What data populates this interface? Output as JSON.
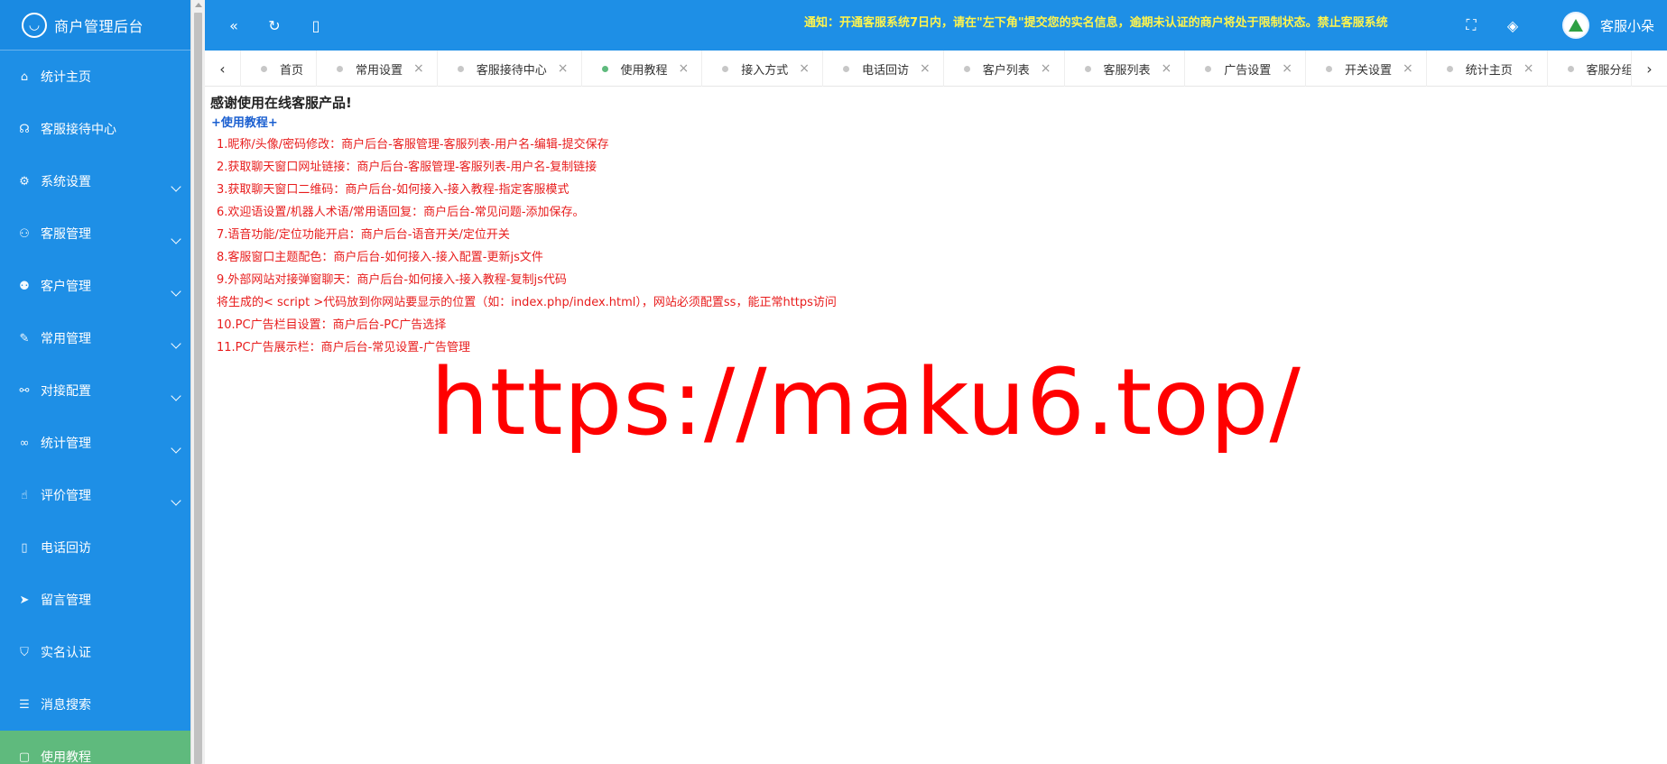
{
  "sidebar": {
    "brand": "商户管理后台",
    "items": [
      {
        "label": "统计主页",
        "icon": "home-icon",
        "glyph": "⌂",
        "dropdown": false
      },
      {
        "label": "客服接待中心",
        "icon": "headset-icon",
        "glyph": "☊",
        "dropdown": false
      },
      {
        "label": "系统设置",
        "icon": "gear-icon",
        "glyph": "⚙",
        "dropdown": true
      },
      {
        "label": "客服管理",
        "icon": "user-icon",
        "glyph": "⚇",
        "dropdown": true
      },
      {
        "label": "客户管理",
        "icon": "users-icon",
        "glyph": "⚉",
        "dropdown": true
      },
      {
        "label": "常用管理",
        "icon": "edit-icon",
        "glyph": "✎",
        "dropdown": true
      },
      {
        "label": "对接配置",
        "icon": "connect-icon",
        "glyph": "⚯",
        "dropdown": true
      },
      {
        "label": "统计管理",
        "icon": "infinity-icon",
        "glyph": "∞",
        "dropdown": true
      },
      {
        "label": "评价管理",
        "icon": "thumbs-up-icon",
        "glyph": "☝",
        "dropdown": true
      },
      {
        "label": "电话回访",
        "icon": "phone-icon",
        "glyph": "▯",
        "dropdown": false
      },
      {
        "label": "留言管理",
        "icon": "send-icon",
        "glyph": "➤",
        "dropdown": false
      },
      {
        "label": "实名认证",
        "icon": "shield-icon",
        "glyph": "⛉",
        "dropdown": false
      },
      {
        "label": "消息搜索",
        "icon": "list-icon",
        "glyph": "☰",
        "dropdown": false
      },
      {
        "label": "使用教程",
        "icon": "book-icon",
        "glyph": "▢",
        "dropdown": false,
        "active": true
      }
    ]
  },
  "header": {
    "notice": "通知：开通客服系统7日内，请在\"左下角\"提交您的实名信息，逾期未认证的商户将处于限制状态。禁止客服系统",
    "user_name": "客服小朵",
    "icons": {
      "collapse": "«",
      "refresh": "↻",
      "mobile": "▯",
      "fullscreen": "⛶",
      "layers": "◈"
    }
  },
  "tabs": {
    "prev": "‹",
    "next": "›",
    "close": "×",
    "items": [
      {
        "label": "首页",
        "closable": false
      },
      {
        "label": "常用设置",
        "closable": true
      },
      {
        "label": "客服接待中心",
        "closable": true
      },
      {
        "label": "使用教程",
        "closable": true,
        "active": true
      },
      {
        "label": "接入方式",
        "closable": true
      },
      {
        "label": "电话回访",
        "closable": true
      },
      {
        "label": "客户列表",
        "closable": true
      },
      {
        "label": "客服列表",
        "closable": true
      },
      {
        "label": "广告设置",
        "closable": true
      },
      {
        "label": "开关设置",
        "closable": true
      },
      {
        "label": "统计主页",
        "closable": true
      },
      {
        "label": "客服分组",
        "closable": false
      }
    ]
  },
  "content": {
    "headline": "感谢使用在线客服产品!",
    "link": "+使用教程+",
    "steps": [
      "1.昵称/头像/密码修改：商户后台-客服管理-客服列表-用户名-编辑-提交保存",
      "2.获取聊天窗口网址链接：商户后台-客服管理-客服列表-用户名-复制链接",
      "3.获取聊天窗口二维码：商户后台-如何接入-接入教程-指定客服模式",
      "6.欢迎语设置/机器人术语/常用语回复：商户后台-常见问题-添加保存。",
      "7.语音功能/定位功能开启：商户后台-语音开关/定位开关",
      "8.客服窗口主题配色：商户后台-如何接入-接入配置-更新js文件",
      "9.外部网站对接弹窗聊天：商户后台-如何接入-接入教程-复制js代码",
      "将生成的< script >代码放到你网站要显示的位置（如：index.php/index.html），网站必须配置ss，能正常https访问",
      "10.PC广告栏目设置：商户后台-PC广告选择",
      "11.PC广告展示栏：商户后台-常见设置-广告管理"
    ],
    "watermark": "https://maku6.top/"
  }
}
